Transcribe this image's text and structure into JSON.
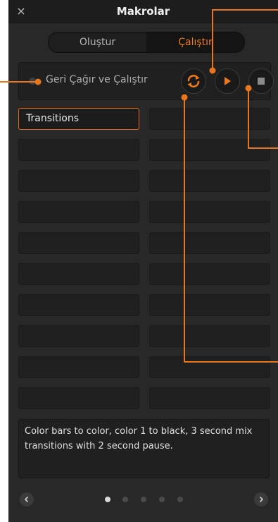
{
  "window": {
    "title": "Makrolar",
    "close_symbol": "×"
  },
  "tabs": [
    {
      "label": "Oluştur",
      "active": false
    },
    {
      "label": "Çalıştır",
      "active": true
    }
  ],
  "run_bar": {
    "recall_and_run_label": "Geri Çağır ve Çalıştır"
  },
  "macro_slots": [
    "Transitions",
    "",
    "",
    "",
    "",
    "",
    "",
    "",
    "",
    "",
    "",
    "",
    "",
    "",
    "",
    "",
    "",
    "",
    "",
    ""
  ],
  "selected_slot": "Transitions",
  "description": "Color bars to color, color 1 to black, 3 second mix transitions with 2 second pause.",
  "pager": {
    "page_count": 5,
    "current_page": 1
  },
  "colors": {
    "accent": "#f07a1a",
    "panel": "#282828",
    "titlebar": "#1d1d1d",
    "slot": "#202020"
  }
}
